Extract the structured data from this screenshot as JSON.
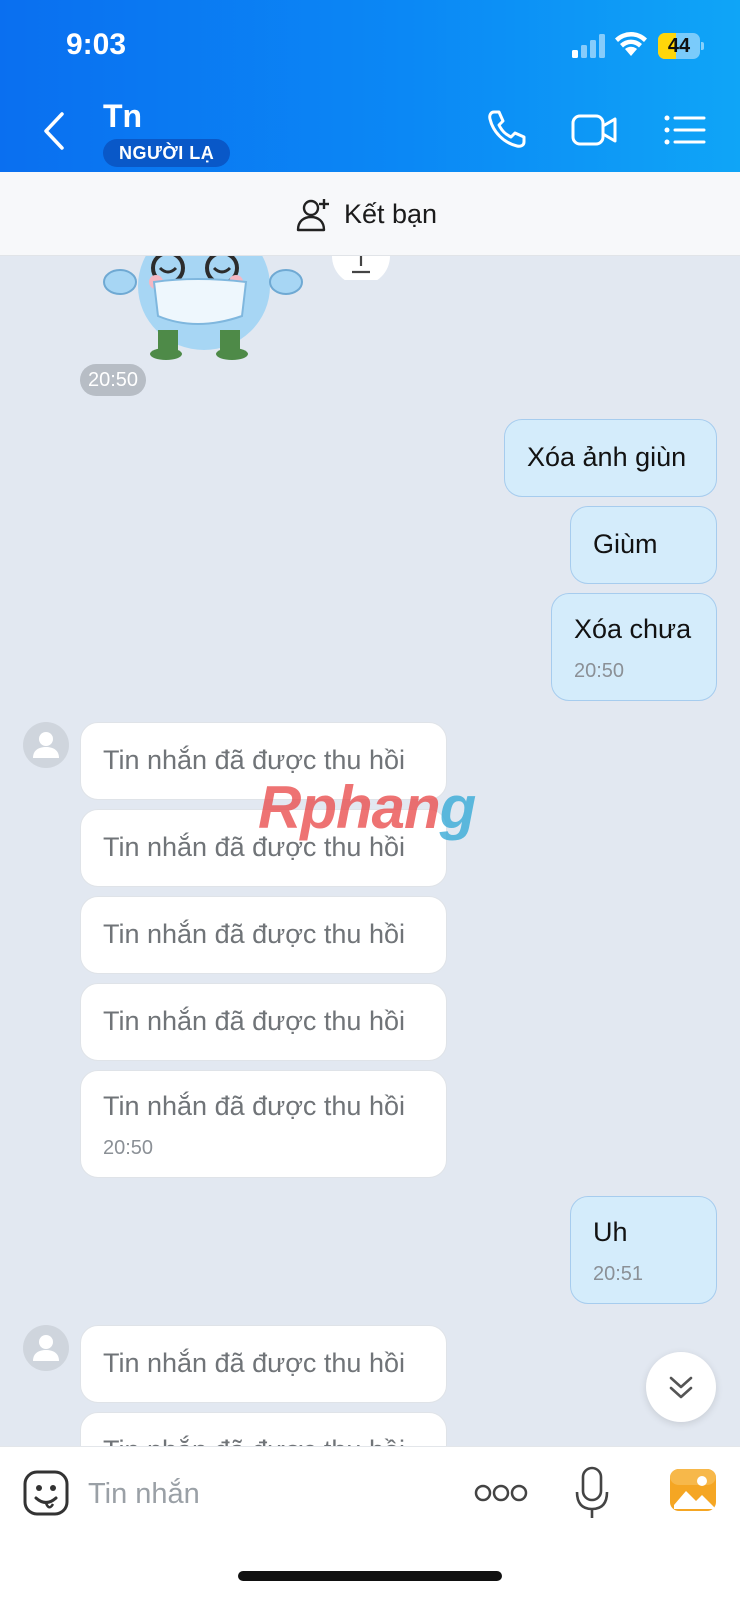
{
  "status_bar": {
    "time": "9:03",
    "battery": "44",
    "battery_level_percent": 44,
    "signal_icon": "cellular-signal-icon",
    "wifi_icon": "wifi-icon"
  },
  "header": {
    "contact_name": "Tn",
    "badge": "NGƯỜI LẠ",
    "back_icon": "chevron-left-icon",
    "call_icon": "phone-icon",
    "video_icon": "video-camera-icon",
    "menu_icon": "list-menu-icon",
    "gradient_colors": [
      "#0a6ff0",
      "#0fa5f7"
    ]
  },
  "add_friend": {
    "label": "Kết bạn",
    "icon": "add-person-icon"
  },
  "chat": {
    "sticker_time": "20:50",
    "outgoing_1": {
      "text": "Xóa ảnh giùn"
    },
    "outgoing_2": {
      "text": "Giùm"
    },
    "outgoing_3": {
      "text": "Xóa chưa",
      "time": "20:50"
    },
    "incoming_group_1": [
      {
        "text": "Tin nhắn đã được thu hồi"
      },
      {
        "text": "Tin nhắn đã được thu hồi"
      },
      {
        "text": "Tin nhắn đã được thu hồi"
      },
      {
        "text": "Tin nhắn đã được thu hồi"
      },
      {
        "text": "Tin nhắn đã được thu hồi",
        "time": "20:50"
      }
    ],
    "outgoing_4": {
      "text": "Uh",
      "time": "20:51"
    },
    "incoming_group_2": [
      {
        "text": "Tin nhắn đã được thu hồi"
      },
      {
        "text": "Tin nhắn đã được thu hồi"
      }
    ],
    "outgoing_bubble_color": "#d4ecfb",
    "incoming_bubble_color": "#ffffff"
  },
  "watermark": {
    "part1": "Rphan",
    "part2": "g"
  },
  "input_bar": {
    "placeholder": "Tin nhắn",
    "emoji_icon": "emoji-sticker-icon",
    "more_icon": "more-dots-icon",
    "mic_icon": "microphone-icon",
    "photo_icon": "photo-gallery-icon"
  },
  "scroll_down_icon": "double-chevron-down-icon"
}
